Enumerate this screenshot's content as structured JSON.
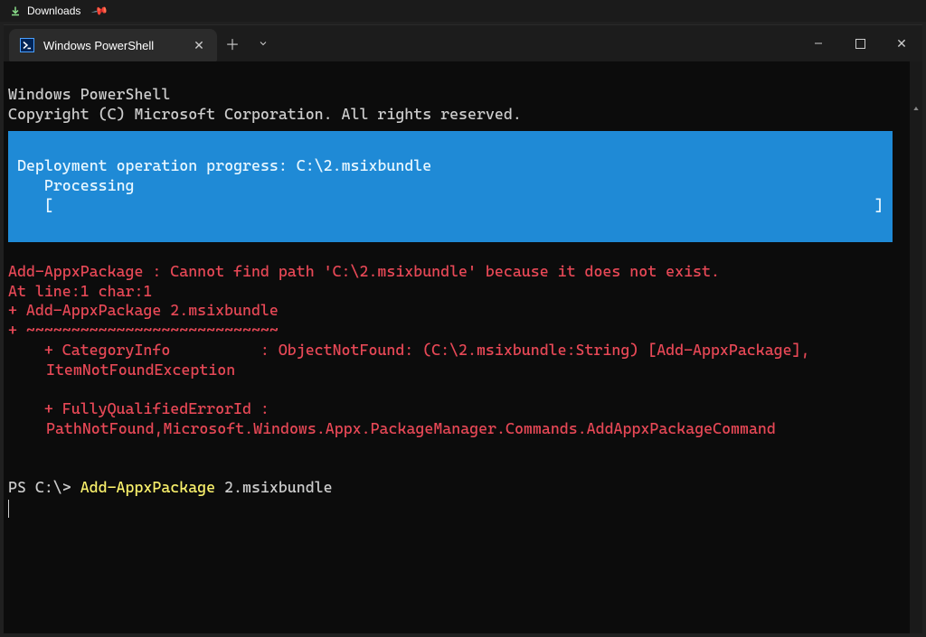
{
  "taskbar": {
    "label": "Downloads"
  },
  "tab": {
    "title": "Windows PowerShell"
  },
  "terminal": {
    "header_line1": "Windows PowerShell",
    "header_line2": "Copyright (C) Microsoft Corporation. All rights reserved.",
    "deploy": {
      "line1": "Deployment operation progress: C:\\2.msixbundle",
      "line2": "   Processing",
      "bar_open": "   [",
      "bar_close": "]"
    },
    "error": {
      "l1": "Add-AppxPackage : Cannot find path 'C:\\2.msixbundle' because it does not exist.",
      "l2": "At line:1 char:1",
      "l3": "+ Add-AppxPackage 2.msixbundle",
      "l4": "+ ~~~~~~~~~~~~~~~~~~~~~~~~~~~~",
      "l5": "    + CategoryInfo          : ObjectNotFound: (C:\\2.msixbundle:String) [Add-AppxPackage], ItemNotFoundException",
      "l6": "    + FullyQualifiedErrorId : PathNotFound,Microsoft.Windows.Appx.PackageManager.Commands.AddAppxPackageCommand"
    },
    "prompt": {
      "prefix": "PS C:\\> ",
      "command": "Add-AppxPackage",
      "arg": " 2.msixbundle"
    }
  }
}
